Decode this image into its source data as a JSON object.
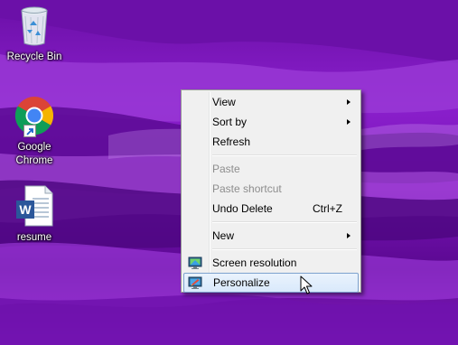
{
  "desktop": {
    "icons": [
      {
        "label": "Recycle Bin",
        "icon": "recycle-bin-icon"
      },
      {
        "label": "Google\nChrome",
        "icon": "chrome-icon"
      },
      {
        "label": "resume",
        "icon": "word-document-icon"
      }
    ]
  },
  "context_menu": {
    "items": {
      "view": {
        "label": "View",
        "has_submenu": true
      },
      "sort_by": {
        "label": "Sort by",
        "has_submenu": true
      },
      "refresh": {
        "label": "Refresh"
      },
      "paste": {
        "label": "Paste",
        "disabled": true
      },
      "paste_shortcut": {
        "label": "Paste shortcut",
        "disabled": true
      },
      "undo_delete": {
        "label": "Undo Delete",
        "shortcut": "Ctrl+Z"
      },
      "new": {
        "label": "New",
        "has_submenu": true
      },
      "screen_resolution": {
        "label": "Screen resolution",
        "icon": "display-icon"
      },
      "personalize": {
        "label": "Personalize",
        "icon": "personalize-icon",
        "highlighted": true
      }
    }
  },
  "colors": {
    "wallpaper_primary": "#7a14b8",
    "menu_background": "#f0f0f0",
    "menu_highlight_border": "#7da2ce",
    "disabled_text": "#8d8d8d"
  }
}
